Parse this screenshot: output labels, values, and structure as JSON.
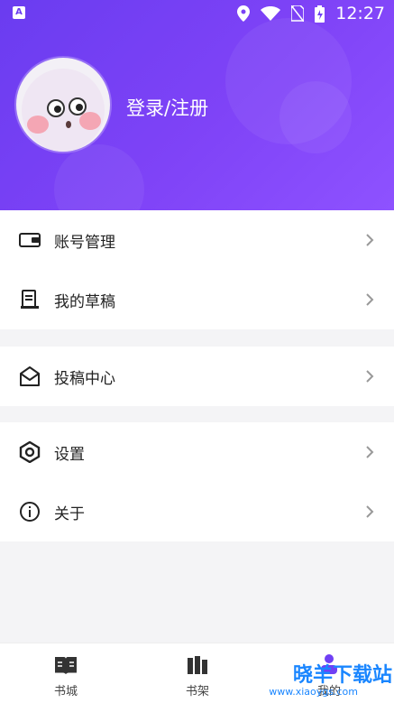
{
  "status_bar": {
    "time": "12:27",
    "app_icon_letter": "A"
  },
  "header": {
    "login_text": "登录/注册",
    "background_color": "#7040f4"
  },
  "menu_groups": [
    {
      "items": [
        {
          "label": "账号管理",
          "icon": "wallet-icon"
        },
        {
          "label": "我的草稿",
          "icon": "drafts-icon"
        }
      ]
    },
    {
      "items": [
        {
          "label": "投稿中心",
          "icon": "mail-open-icon"
        }
      ]
    },
    {
      "items": [
        {
          "label": "设置",
          "icon": "settings-hex-icon"
        },
        {
          "label": "关于",
          "icon": "info-icon"
        }
      ]
    }
  ],
  "bottom_nav": {
    "tabs": [
      {
        "label": "书城",
        "icon": "book-open-icon"
      },
      {
        "label": "书架",
        "icon": "bookshelf-icon"
      },
      {
        "label": "我的",
        "icon": "profile-icon",
        "active": true
      }
    ]
  },
  "watermark": {
    "text": "晓羊下载站",
    "url": "www.xiaoygs.com"
  }
}
